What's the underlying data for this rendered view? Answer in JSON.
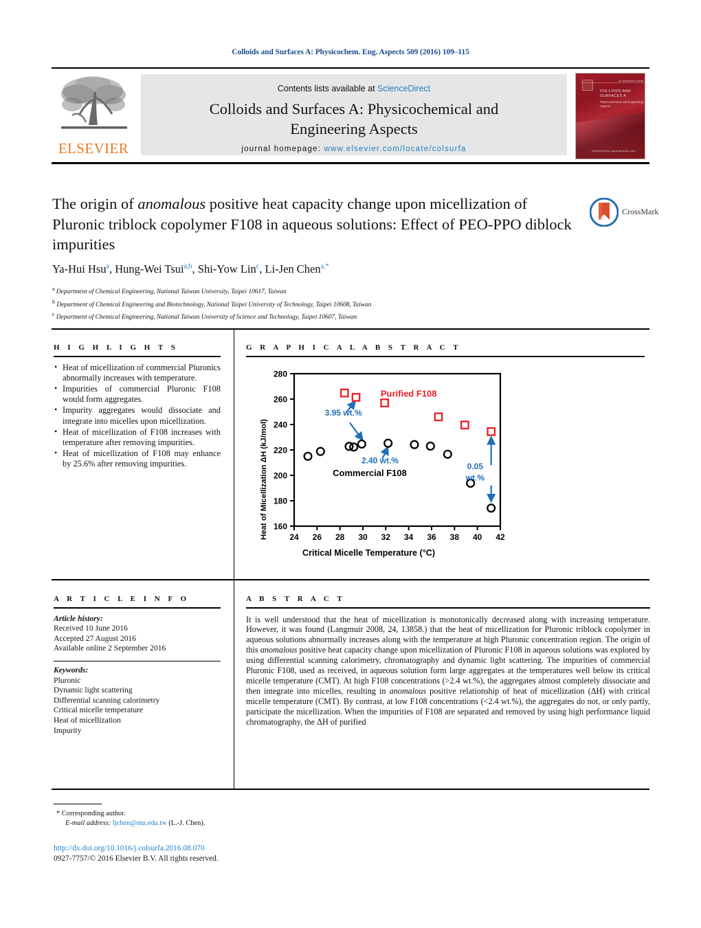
{
  "running_head": "Colloids and Surfaces A: Physicochem. Eng. Aspects 509 (2016) 109–115",
  "masthead": {
    "contents_prefix": "Contents lists available at ",
    "sciencedirect": "ScienceDirect",
    "journal_title_line1": "Colloids and Surfaces A: Physicochemical and",
    "journal_title_line2": "Engineering Aspects",
    "homepage_prefix": "journal homepage: ",
    "homepage_url": "www.elsevier.com/locate/colsurfa",
    "publisher": "ELSEVIER",
    "cover": {
      "top_banner": "An International Journal",
      "title": "COLLOIDS AND SURFACES A",
      "subtitle": "Physicochemical and Engineering Aspects",
      "bottom": "ScienceDirect    www.elsevier.com"
    }
  },
  "article": {
    "title_part1": "The origin of ",
    "title_italic": "anomalous",
    "title_part2": " positive heat capacity change upon micellization of Pluronic triblock copolymer F108 in aqueous solutions: Effect of PEO-PPO diblock impurities",
    "crossmark_label": "CrossMark",
    "authors": [
      {
        "name": "Ya-Hui Hsu",
        "marks": "a",
        "sep": ", "
      },
      {
        "name": "Hung-Wei Tsui",
        "marks": "a,b",
        "sep": ", "
      },
      {
        "name": "Shi-Yow Lin",
        "marks": "c",
        "sep": ", "
      },
      {
        "name": "Li-Jen Chen",
        "marks": "a,*",
        "sep": ""
      }
    ],
    "affiliations": [
      {
        "mark": "a",
        "text": "Department of Chemical Engineering, National Taiwan University, Taipei 10617, Taiwan"
      },
      {
        "mark": "b",
        "text": "Department of Chemical Engineering and Biotechnology, National Taipei University of Technology, Taipei 10608, Taiwan"
      },
      {
        "mark": "c",
        "text": "Department of Chemical Engineering, National Taiwan University of Science and Technology, Taipei 10607, Taiwan"
      }
    ]
  },
  "highlights": {
    "heading": "H I G H L I G H T S",
    "items": [
      "Heat of micellization of commercial Pluronics abnormally increases with temperature.",
      "Impurities of commercial Pluronic F108 would form aggregates.",
      "Impurity aggregates would dissociate and integrate into micelles upon micellization.",
      "Heat of micellization of F108 increases with temperature after removing impurities.",
      "Heat of micellization of F108 may enhance by 25.6% after removing impurities."
    ]
  },
  "graphical_abstract": {
    "heading": "G R A P H I C A L   A B S T R A C T"
  },
  "chart_data": {
    "type": "scatter",
    "title": "",
    "xlabel": "Critical Micelle Temperature (°C)",
    "ylabel": "Heat of Micellization ΔH (kJ/mol)",
    "xlim": [
      24,
      42
    ],
    "ylim": [
      160,
      280
    ],
    "xticks": [
      24,
      26,
      28,
      30,
      32,
      34,
      36,
      38,
      40,
      42
    ],
    "yticks": [
      160,
      180,
      200,
      220,
      240,
      260,
      280
    ],
    "grid": false,
    "legend_position": "in-plot-annotations",
    "series": [
      {
        "name": "Commercial F108",
        "marker": "open-circle",
        "color": "#000000",
        "points": [
          [
            25.2,
            215.0
          ],
          [
            26.3,
            218.8
          ],
          [
            28.8,
            222.8
          ],
          [
            29.2,
            222.3
          ],
          [
            29.9,
            224.6
          ],
          [
            32.2,
            225.3
          ],
          [
            34.5,
            224.2
          ],
          [
            35.9,
            223.0
          ],
          [
            37.4,
            216.6
          ],
          [
            39.4,
            193.8
          ],
          [
            41.2,
            174.2
          ]
        ]
      },
      {
        "name": "Purified F108",
        "marker": "open-square",
        "color": "#ee1c25",
        "points": [
          [
            28.4,
            264.8
          ],
          [
            29.4,
            261.4
          ],
          [
            31.9,
            257.0
          ],
          [
            36.6,
            246.0
          ],
          [
            38.9,
            239.6
          ],
          [
            41.2,
            234.4
          ]
        ]
      }
    ],
    "annotations": [
      {
        "text": "Purified F108",
        "color": "#ee1c25",
        "x": 34.0,
        "y": 262.0
      },
      {
        "text": "Commercial F108",
        "color": "#000000",
        "x": 30.6,
        "y": 199.5
      },
      {
        "text": "3.95 wt.%",
        "color": "#1f6fb8",
        "x": 28.3,
        "y": 247.0
      },
      {
        "text": "2.40 wt.%",
        "color": "#1f6fb8",
        "x": 31.5,
        "y": 209.5
      },
      {
        "text": "0.05",
        "color": "#1f6fb8",
        "x": 39.8,
        "y": 205.0
      },
      {
        "text": "wt.%",
        "color": "#1f6fb8",
        "x": 39.8,
        "y": 196.0
      }
    ]
  },
  "article_info": {
    "heading": "A R T I C L E   I N F O",
    "history_heading": "Article history:",
    "history": [
      "Received 10 June 2016",
      "Accepted 27 August 2016",
      "Available online 2 September 2016"
    ],
    "keywords_heading": "Keywords:",
    "keywords": [
      "Pluronic",
      "Dynamic light scattering",
      "Differential scanning calorimetry",
      "Critical micelle temperature",
      "Heat of micellization",
      "Impurity"
    ]
  },
  "abstract": {
    "heading": "A B S T R A C T",
    "seg1": "It is well understood that the heat of micellization is monotonically decreased along with increasing temperature. However, it was found (Langmuir 2008, 24, 13858.) that the heat of micellization for Pluronic triblock copolymer in aqueous solutions abnormally increases along with the temperature at high Pluronic concentration region. The origin of this ",
    "it1": "anomalous",
    "seg2": " positive heat capacity change upon micellization of Pluronic F108 in aqueous solutions was explored by using differential scanning calorimetry, chromatography and dynamic light scattering. The impurities of commercial Pluronic F108, used as received, in aqueous solution form large aggregates at the temperatures well below its critical micelle temperature (CMT). At high F108 concentrations (>2.4 wt.%), the aggregates almost completely dissociate and then integrate into micelles, resulting in ",
    "it2": "anomalous",
    "seg3": " positive relationship of heat of micellization (ΔH) with critical micelle temperature (CMT). By contrast, at low F108 concentrations (<2.4 wt.%), the aggregates do not, or only partly, participate the micellization. When the impurities of F108 are separated and removed by using high performance liquid chromatography, the ΔH of purified"
  },
  "footer": {
    "corresponding_marker": "*",
    "corresponding_text": "Corresponding author.",
    "email_label": "E-mail address:",
    "email": "ljchen@ntu.edu.tw",
    "email_suffix": " (L.-J. Chen).",
    "doi": "http://dx.doi.org/10.1016/j.colsurfa.2016.08.070",
    "copyright": "0927-7757/© 2016 Elsevier B.V. All rights reserved."
  },
  "colors": {
    "link": "#1f7fc4",
    "elsevier_orange": "#E87722",
    "purified_red": "#ee1c25",
    "annotation_blue": "#1f6fb8",
    "masthead_bg": "#e6e6e6"
  }
}
